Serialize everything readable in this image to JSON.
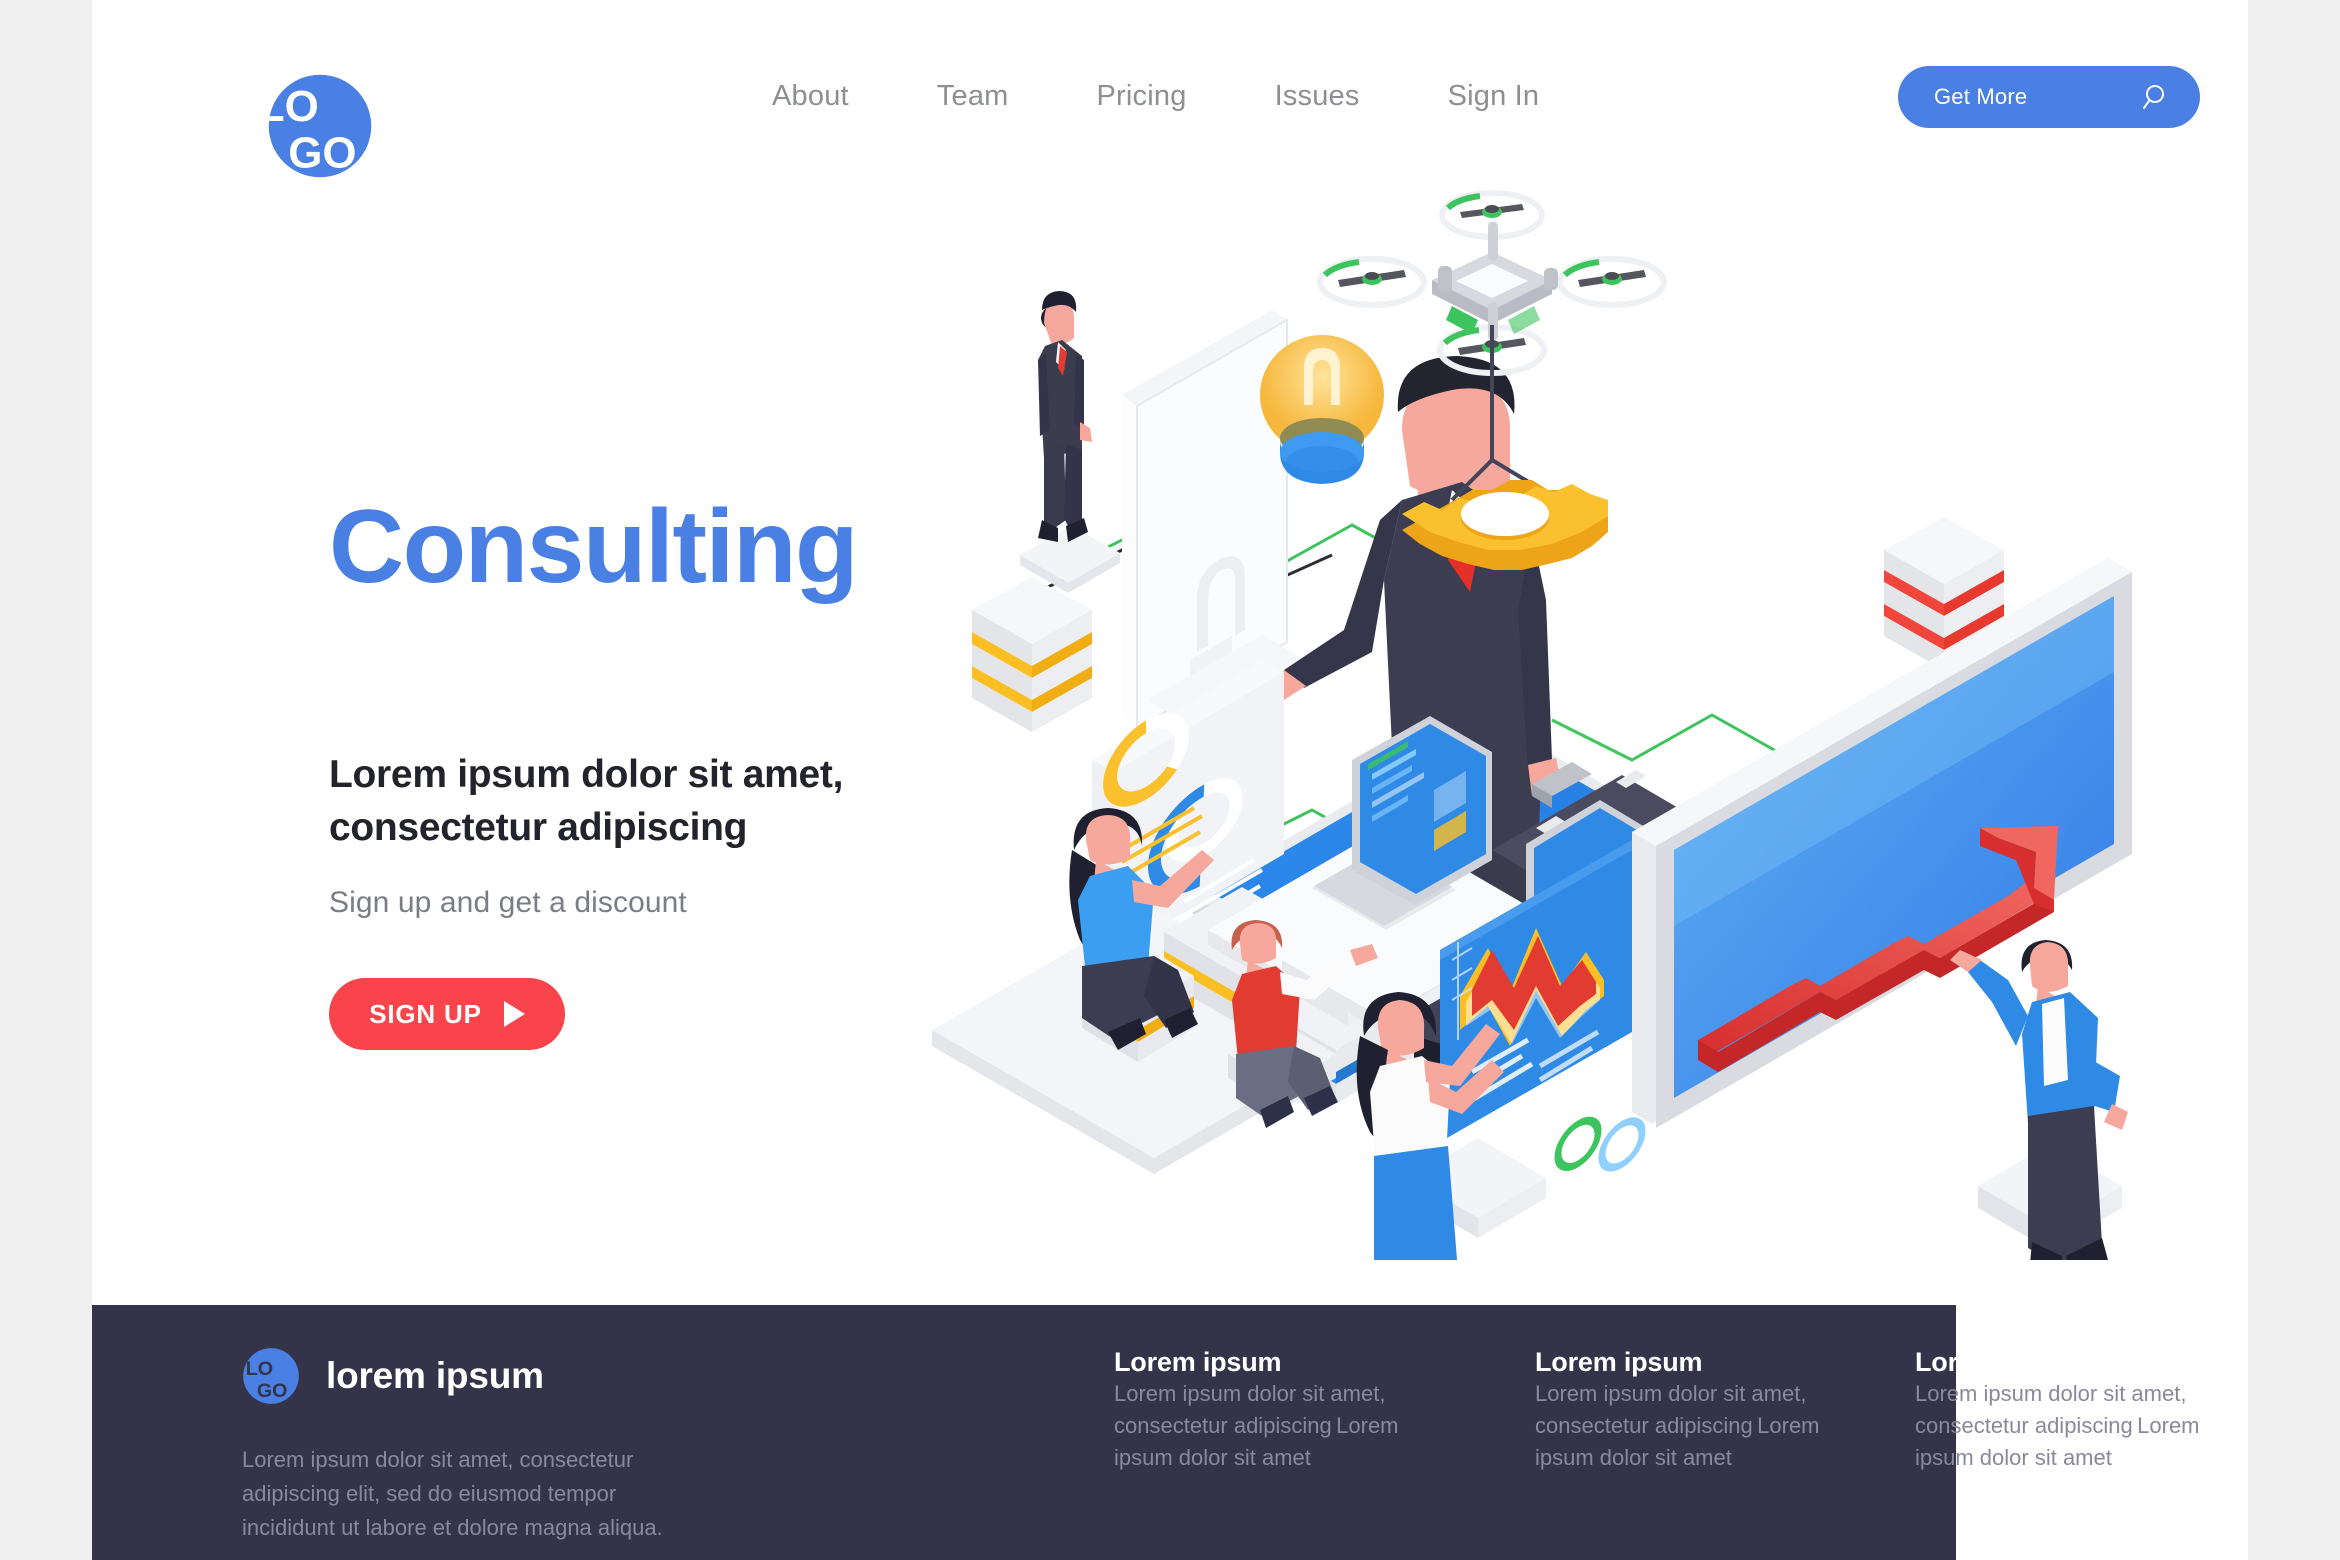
{
  "colors": {
    "brand_blue": "#4a7fe4",
    "accent_red": "#f9444c",
    "footer_bg": "#353349",
    "page_bg": "#f0f0f0",
    "nav_text": "#8d8f95",
    "heading_dark": "#23232b",
    "muted": "#7b7d86",
    "footer_muted": "#8a889b",
    "illus_gold": "#ffc233",
    "illus_green": "#3dc45e"
  },
  "header": {
    "logo": {
      "icon": "logo-circle-icon",
      "text_top": "LO",
      "text_bottom": "GO"
    },
    "nav": [
      {
        "label": "About"
      },
      {
        "label": "Team"
      },
      {
        "label": "Pricing"
      },
      {
        "label": "Issues"
      },
      {
        "label": "Sign In"
      }
    ],
    "cta": {
      "label": "Get More",
      "icon": "search-icon"
    }
  },
  "hero": {
    "title": "Consulting",
    "subtitle": "Lorem ipsum dolor sit amet, consectetur adipiscing",
    "note": "Sign up and get a discount",
    "button": {
      "label": "SIGN UP",
      "icon": "play-icon"
    }
  },
  "illustration": {
    "scene_name": "isometric-business-consulting-scene",
    "elements": [
      "desktop-monitor",
      "businessman-small",
      "lightbulb-icon",
      "businessman-main-with-briefcase",
      "tablet-platform",
      "drone-icon",
      "gear-icon",
      "stacked-blocks-red",
      "stacked-blocks-yellow",
      "donut-chart-card",
      "two-workers-laptops",
      "woman-touchscreen-wave-chart",
      "growth-arrow-screen",
      "man-pointing",
      "connector-lines"
    ]
  },
  "footer": {
    "brand": {
      "logo_top": "LO",
      "logo_bottom": "GO",
      "name": "lorem ipsum",
      "description": "Lorem ipsum dolor sit amet, consectetur adipiscing elit, sed do eiusmod tempor incididunt ut labore et dolore magna aliqua."
    },
    "columns": [
      {
        "title": "Lorem ipsum",
        "link1": "Lorem ipsum dolor sit amet, consectetur adipiscing",
        "link2": "Lorem ipsum dolor sit amet"
      },
      {
        "title": "Lorem ipsum",
        "link1": "Lorem ipsum dolor sit amet, consectetur adipiscing",
        "link2": "Lorem ipsum dolor sit amet"
      },
      {
        "title": "Lorem ipsum",
        "link1": "Lorem ipsum dolor sit amet, consectetur adipiscing",
        "link2": "Lorem ipsum dolor sit amet"
      }
    ]
  }
}
